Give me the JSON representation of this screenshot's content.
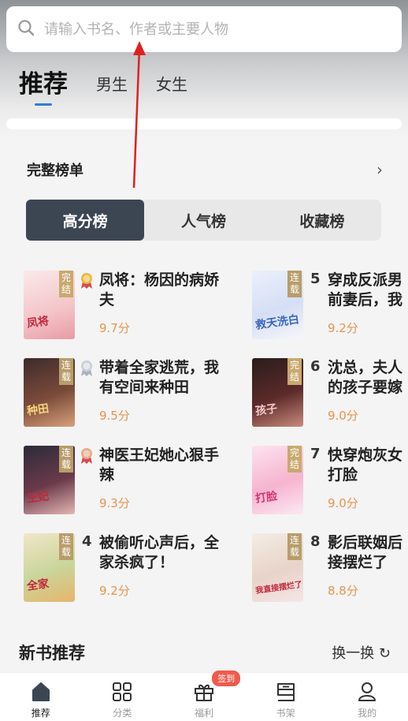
{
  "search": {
    "placeholder": "请输入书名、作者或主要人物"
  },
  "top_tabs": [
    "推荐",
    "男生",
    "女生"
  ],
  "ranking": {
    "title": "完整榜单",
    "segments": [
      "高分榜",
      "人气榜",
      "收藏榜"
    ]
  },
  "books": [
    {
      "rank": "1",
      "name": "凤将：杨因的病娇夫",
      "score": "9.7分",
      "status": "完结",
      "cover_text": "凤将"
    },
    {
      "rank": "2",
      "name": "带着全家逃荒，我有空间来种田",
      "score": "9.5分",
      "status": "连载",
      "cover_text": "种田"
    },
    {
      "rank": "3",
      "name": "神医王妃她心狠手辣",
      "score": "9.3分",
      "status": "连载",
      "cover_text": "王妃"
    },
    {
      "rank": "4",
      "name": "被偷听心声后，全家杀疯了！",
      "score": "9.2分",
      "status": "连载",
      "cover_text": "全家"
    },
    {
      "rank": "5",
      "name": "穿成反派男前妻后，我",
      "score": "9.2分",
      "status": "连载",
      "cover_text": "救天洗白"
    },
    {
      "rank": "6",
      "name": "沈总，夫人的孩子要嫁",
      "score": "9.0分",
      "status": "完结",
      "cover_text": "孩子"
    },
    {
      "rank": "7",
      "name": "快穿炮灰女打脸",
      "score": "9.0分",
      "status": "完结",
      "cover_text": "打脸"
    },
    {
      "rank": "8",
      "name": "影后联姻后接摆烂了",
      "score": "8.8分",
      "status": "连载",
      "cover_text": "我直接摆烂了"
    }
  ],
  "new_books": {
    "title": "新书推荐",
    "refresh": "换一换 ↻"
  },
  "bottom_nav": [
    {
      "label": "推荐",
      "icon": "home-icon"
    },
    {
      "label": "分类",
      "icon": "grid-icon"
    },
    {
      "label": "福利",
      "icon": "gift-icon",
      "badge": "签到"
    },
    {
      "label": "书架",
      "icon": "bookshelf-icon"
    },
    {
      "label": "我的",
      "icon": "user-icon"
    }
  ],
  "colors": {
    "accent": "#2d7be0",
    "segment_active": "#3c4653",
    "score": "#e8944c",
    "badge": "#f05a4a"
  }
}
